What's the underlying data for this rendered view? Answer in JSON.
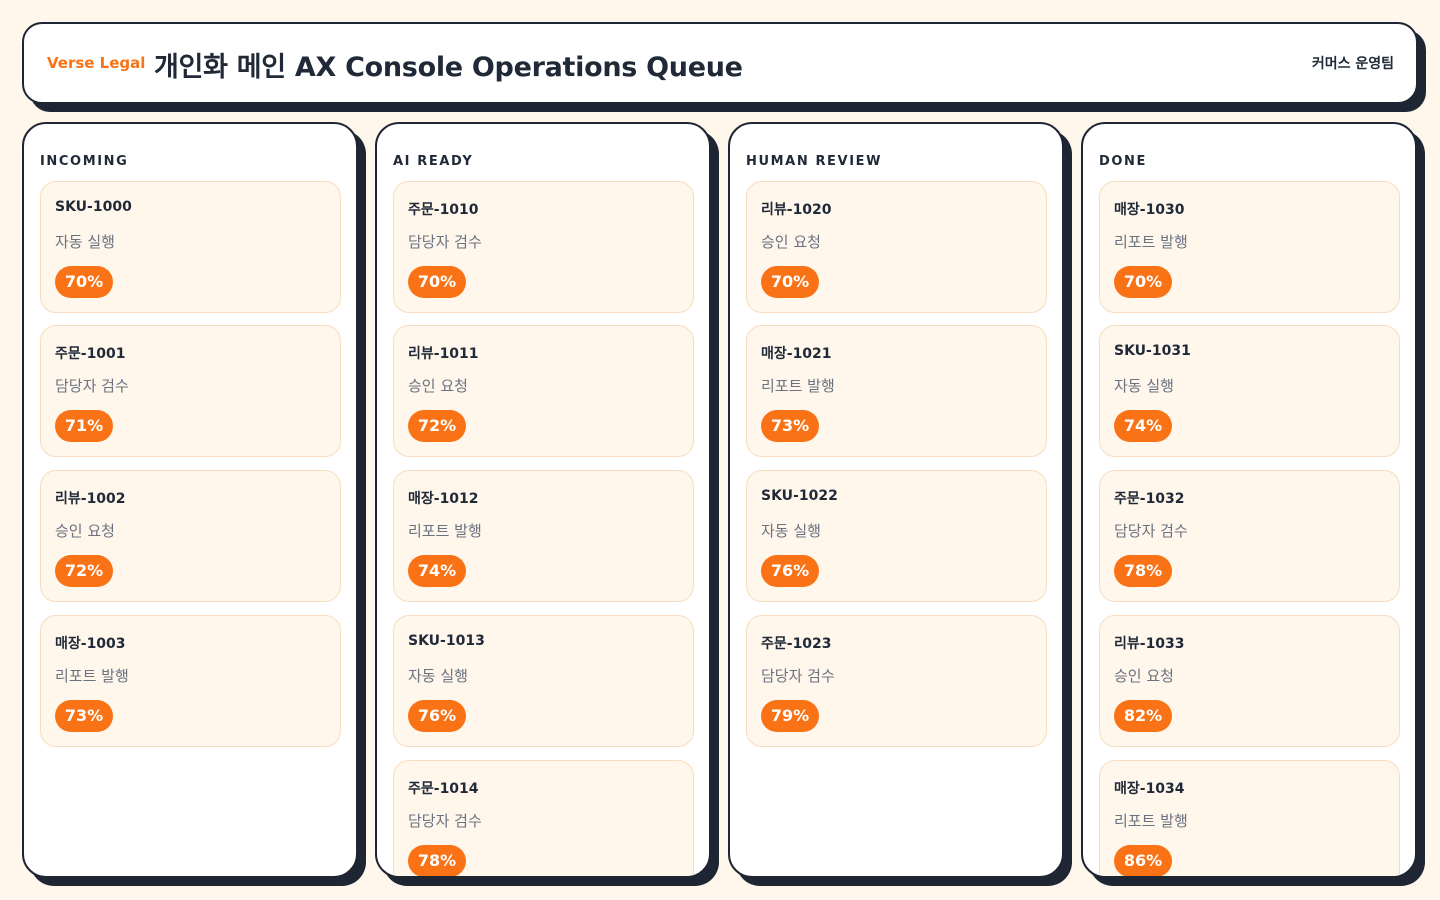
{
  "header": {
    "brand": "Verse Legal",
    "title": "개인화 메인 AX Console Operations Queue",
    "team": "커머스 운영팀"
  },
  "colors": {
    "accent": "#f97316",
    "page_background": "#fff6ec",
    "card_background": "#fff6ec",
    "card_border": "#f9dcc0",
    "outline": "#1e2633"
  },
  "columns": [
    {
      "title": "INCOMING",
      "cards": [
        {
          "id": "SKU-1000",
          "desc": "자동 실행",
          "progress": "70%"
        },
        {
          "id": "주문-1001",
          "desc": "담당자 검수",
          "progress": "71%"
        },
        {
          "id": "리뷰-1002",
          "desc": "승인 요청",
          "progress": "72%"
        },
        {
          "id": "매장-1003",
          "desc": "리포트 발행",
          "progress": "73%"
        }
      ]
    },
    {
      "title": "AI READY",
      "cards": [
        {
          "id": "주문-1010",
          "desc": "담당자 검수",
          "progress": "70%"
        },
        {
          "id": "리뷰-1011",
          "desc": "승인 요청",
          "progress": "72%"
        },
        {
          "id": "매장-1012",
          "desc": "리포트 발행",
          "progress": "74%"
        },
        {
          "id": "SKU-1013",
          "desc": "자동 실행",
          "progress": "76%"
        },
        {
          "id": "주문-1014",
          "desc": "담당자 검수",
          "progress": "78%"
        }
      ]
    },
    {
      "title": "HUMAN REVIEW",
      "cards": [
        {
          "id": "리뷰-1020",
          "desc": "승인 요청",
          "progress": "70%"
        },
        {
          "id": "매장-1021",
          "desc": "리포트 발행",
          "progress": "73%"
        },
        {
          "id": "SKU-1022",
          "desc": "자동 실행",
          "progress": "76%"
        },
        {
          "id": "주문-1023",
          "desc": "담당자 검수",
          "progress": "79%"
        }
      ]
    },
    {
      "title": "DONE",
      "cards": [
        {
          "id": "매장-1030",
          "desc": "리포트 발행",
          "progress": "70%"
        },
        {
          "id": "SKU-1031",
          "desc": "자동 실행",
          "progress": "74%"
        },
        {
          "id": "주문-1032",
          "desc": "담당자 검수",
          "progress": "78%"
        },
        {
          "id": "리뷰-1033",
          "desc": "승인 요청",
          "progress": "82%"
        },
        {
          "id": "매장-1034",
          "desc": "리포트 발행",
          "progress": "86%"
        }
      ]
    }
  ]
}
